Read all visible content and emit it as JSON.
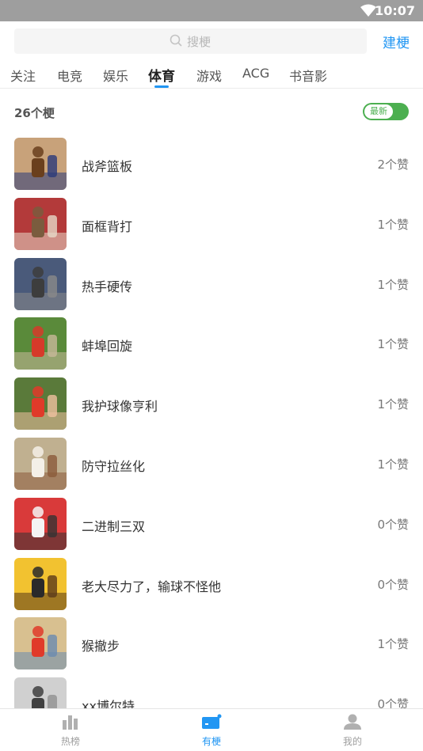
{
  "status": {
    "time": "10:07"
  },
  "search": {
    "placeholder": "搜梗",
    "action_label": "建梗"
  },
  "tabs": [
    {
      "label": "关注"
    },
    {
      "label": "电竞"
    },
    {
      "label": "娱乐"
    },
    {
      "label": "体育"
    },
    {
      "label": "游戏"
    },
    {
      "label": "ACG"
    },
    {
      "label": "书音影"
    }
  ],
  "active_tab": "体育",
  "list_header": {
    "count": "26个梗",
    "toggle_label": "最新"
  },
  "items": [
    {
      "title": "战斧篮板",
      "likes": "2个赞",
      "thumb": "basketball-dunk",
      "colors": [
        "#c8a27a",
        "#6a3f1d",
        "#2a3a7a"
      ]
    },
    {
      "title": "面框背打",
      "likes": "1个赞",
      "thumb": "basketball-post",
      "colors": [
        "#b33a3a",
        "#7a5c3e",
        "#e6d9c8"
      ]
    },
    {
      "title": "热手硬传",
      "likes": "1个赞",
      "thumb": "basketball-players",
      "colors": [
        "#4a5a7a",
        "#3d3d3d",
        "#8a8a8a"
      ]
    },
    {
      "title": "蚌埠回旋",
      "likes": "1个赞",
      "thumb": "football-player",
      "colors": [
        "#5a8a3a",
        "#d63a2a",
        "#c8b89a"
      ]
    },
    {
      "title": "我护球像亨利",
      "likes": "1个赞",
      "thumb": "football-celebration",
      "colors": [
        "#5a7a3a",
        "#e03a2a",
        "#f0c0a0"
      ]
    },
    {
      "title": "防守拉丝化",
      "likes": "1个赞",
      "thumb": "basketball-defense",
      "colors": [
        "#c0b090",
        "#f4f0e8",
        "#8a5a3a"
      ]
    },
    {
      "title": "二进制三双",
      "likes": "0个赞",
      "thumb": "poster-red",
      "colors": [
        "#d93a3a",
        "#f4f4f4",
        "#333333"
      ]
    },
    {
      "title": "老大尽力了，输球不怪他",
      "likes": "0个赞",
      "thumb": "basketball-lakers",
      "colors": [
        "#f2c230",
        "#2a2a2a",
        "#5a3a1a"
      ]
    },
    {
      "title": "猴撤步",
      "likes": "1个赞",
      "thumb": "basketball-stepback",
      "colors": [
        "#d8c090",
        "#e03a2a",
        "#6a8ab0"
      ]
    },
    {
      "title": "xx博尔特",
      "likes": "0个赞",
      "thumb": "sprint-bw",
      "colors": [
        "#d0d0d0",
        "#404040",
        "#909090"
      ]
    }
  ],
  "bottom_nav": [
    {
      "label": "热榜",
      "icon": "bar-chart-icon"
    },
    {
      "label": "有梗",
      "icon": "card-icon"
    },
    {
      "label": "我的",
      "icon": "person-icon"
    }
  ],
  "accent_color": "#2196f3",
  "toggle_color": "#4caf50"
}
